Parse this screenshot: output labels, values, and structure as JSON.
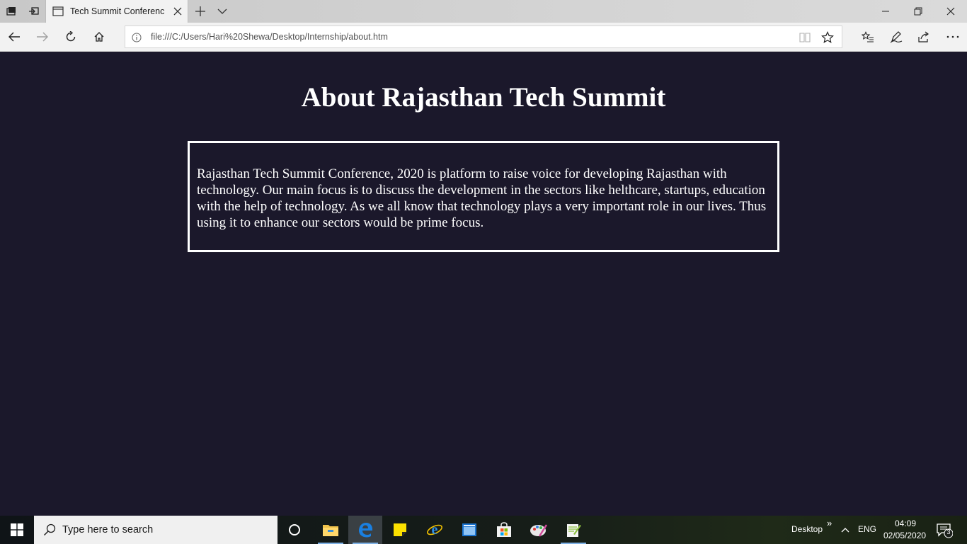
{
  "browser": {
    "tab": {
      "title": "Tech Summit Conferenc"
    },
    "address": {
      "url": "file:///C:/Users/Hari%20Shewa/Desktop/Internship/about.htm"
    }
  },
  "page": {
    "title": "About Rajasthan Tech Summit",
    "about_text": "Rajasthan Tech Summit Conference, 2020 is platform to raise voice for developing Rajasthan with technology. Our main focus is to discuss the development in the sectors like helthcare, startups, education with the help of technology. As we all know that technology plays a very important role in our lives. Thus using it to enhance our sectors would be prime focus."
  },
  "taskbar": {
    "search_placeholder": "Type here to search",
    "tray": {
      "desktop_label": "Desktop",
      "overflow": "»",
      "language": "ENG",
      "time": "04:09",
      "date": "02/05/2020",
      "notification_count": "3"
    }
  },
  "colors": {
    "page_background": "#1b182b",
    "text": "#ffffff",
    "chrome_background": "#f2f2f2",
    "taskbar_search": "#f0f0f0"
  }
}
